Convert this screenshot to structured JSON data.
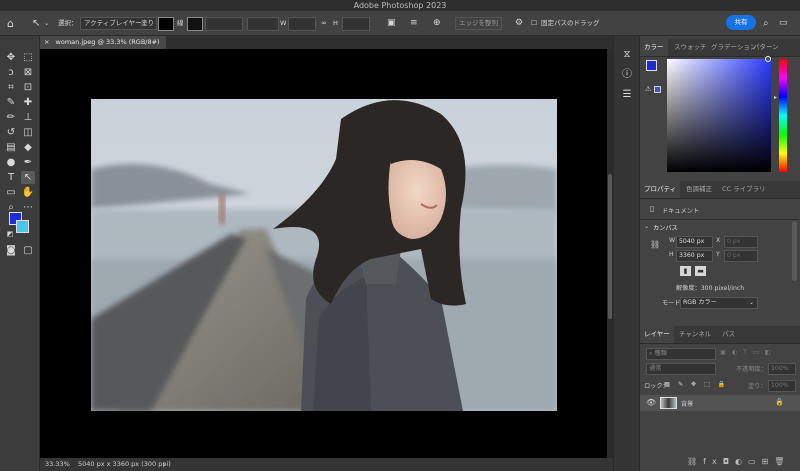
{
  "app": {
    "title": "Adobe Photoshop 2023"
  },
  "options_bar": {
    "select_label": "選択：",
    "select_value": "アクティブレイヤー",
    "fill_label": "塗り",
    "stroke_label": "線",
    "w_label": "W",
    "h_label": "H",
    "align_edges": "エッジを整列",
    "constrain_path": "固定パスのドラッグ",
    "share_button": "共有"
  },
  "document": {
    "tab_title": "woman.jpeg @ 33.3% (RGB/8#)",
    "zoom": "33.33%",
    "info": "5040 px x 3360 px (300 ppi)"
  },
  "color_panel": {
    "tabs": [
      "カラー",
      "スウォッチ",
      "グラデーション",
      "パターン"
    ],
    "foreground": "#1e2bd8",
    "background": "#47c7f0"
  },
  "properties_panel": {
    "tabs": [
      "プロパティ",
      "色調補正",
      "CC ライブラリ"
    ],
    "doc_label": "ドキュメント",
    "canvas_section": "カンバス",
    "w_label": "W",
    "w_value": "5040 px",
    "h_label": "H",
    "h_value": "3360 px",
    "x_label": "X",
    "x_placeholder": "0 px",
    "y_label": "Y",
    "y_placeholder": "0 px",
    "resolution": "解像度：300 pixel/inch",
    "mode_label": "モード",
    "mode_value": "RGB カラー"
  },
  "layers_panel": {
    "tabs": [
      "レイヤー",
      "チャンネル",
      "パス"
    ],
    "search_placeholder": "種類",
    "blend_mode": "通常",
    "opacity_label": "不透明度：",
    "opacity_value": "100%",
    "lock_label": "ロック：",
    "fill_label": "塗り：",
    "fill_value": "100%",
    "layers": [
      {
        "name": "背景",
        "locked": true,
        "visible": true
      }
    ]
  },
  "colors": {
    "accent": "#1473e6"
  }
}
